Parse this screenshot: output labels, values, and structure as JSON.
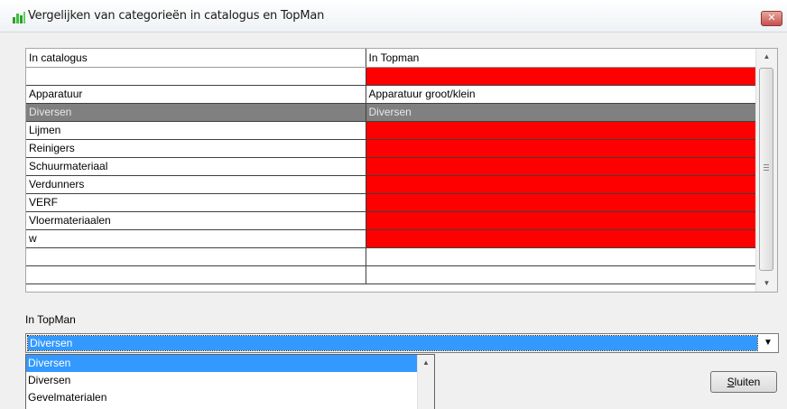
{
  "window": {
    "title": "Vergelijken van categorieën in catalogus en TopMan",
    "close_glyph": "✕",
    "colors": {
      "mismatch": "#ff0000",
      "selected_row": "#808080",
      "highlight": "#3399ff"
    }
  },
  "grid": {
    "columns": [
      "In catalogus",
      "In Topman"
    ],
    "rows": [
      {
        "catalogus": "",
        "topman": "",
        "mismatch": true
      },
      {
        "catalogus": "Apparatuur",
        "topman": "Apparatuur groot/klein",
        "mismatch": false
      },
      {
        "catalogus": "Diversen",
        "topman": "Diversen",
        "mismatch": false,
        "selected": true
      },
      {
        "catalogus": "Lijmen",
        "topman": "",
        "mismatch": true
      },
      {
        "catalogus": "Reinigers",
        "topman": "",
        "mismatch": true
      },
      {
        "catalogus": "Schuurmateriaal",
        "topman": "",
        "mismatch": true
      },
      {
        "catalogus": "Verdunners",
        "topman": "",
        "mismatch": true
      },
      {
        "catalogus": "VERF",
        "topman": "",
        "mismatch": true
      },
      {
        "catalogus": "Vloermateriaalen",
        "topman": "",
        "mismatch": true
      },
      {
        "catalogus": "w",
        "topman": "",
        "mismatch": true
      },
      {
        "catalogus": "",
        "topman": "",
        "mismatch": false
      },
      {
        "catalogus": "",
        "topman": "",
        "mismatch": false
      }
    ]
  },
  "topman": {
    "label": "In TopMan",
    "selected_value": "Diversen",
    "options": [
      "Diversen",
      "Diversen",
      "Gevelmaterialen"
    ]
  },
  "buttons": {
    "close_mnemonic": "S",
    "close_rest": "luiten"
  },
  "scroll_glyphs": {
    "up": "▲",
    "down": "▼",
    "combo_down": "▼"
  }
}
